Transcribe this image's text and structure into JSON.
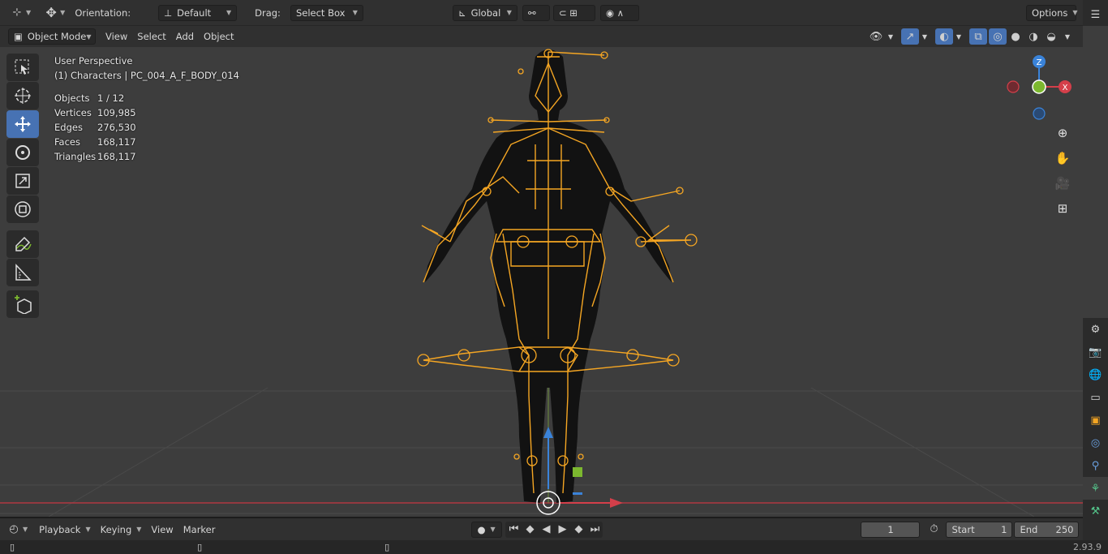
{
  "toolbar": {
    "orientation_label": "Orientation:",
    "orientation_value": "Default",
    "drag_label": "Drag:",
    "drag_value": "Select Box",
    "transform_space": "Global",
    "options_label": "Options"
  },
  "header": {
    "mode": "Object Mode",
    "menus": [
      "View",
      "Select",
      "Add",
      "Object"
    ]
  },
  "overlay": {
    "perspective": "User Perspective",
    "collection": "(1) Characters | PC_004_A_F_BODY_014",
    "stats": [
      {
        "label": "Objects",
        "value": "1 / 12"
      },
      {
        "label": "Vertices",
        "value": "109,985"
      },
      {
        "label": "Edges",
        "value": "276,530"
      },
      {
        "label": "Faces",
        "value": "168,117"
      },
      {
        "label": "Triangles",
        "value": "168,117"
      }
    ]
  },
  "gizmo": {
    "z": "Z",
    "x": "X"
  },
  "timeline": {
    "menus": [
      "Playback",
      "Keying",
      "View",
      "Marker"
    ],
    "current_frame": "1",
    "start_label": "Start",
    "start_value": "1",
    "end_label": "End",
    "end_value": "250"
  },
  "status": {
    "version": "2.93.9"
  },
  "colors": {
    "accent": "#4772b3",
    "armature": "#f5a623",
    "x_axis": "#d43f4a",
    "y_axis": "#7cb82f",
    "z_axis": "#3a83d9"
  },
  "icons": [
    "cursor-select-icon",
    "cursor-icon",
    "move-icon",
    "rotate-icon",
    "scale-icon",
    "transform-icon",
    "annotate-icon",
    "measure-icon",
    "add-cube-icon"
  ]
}
